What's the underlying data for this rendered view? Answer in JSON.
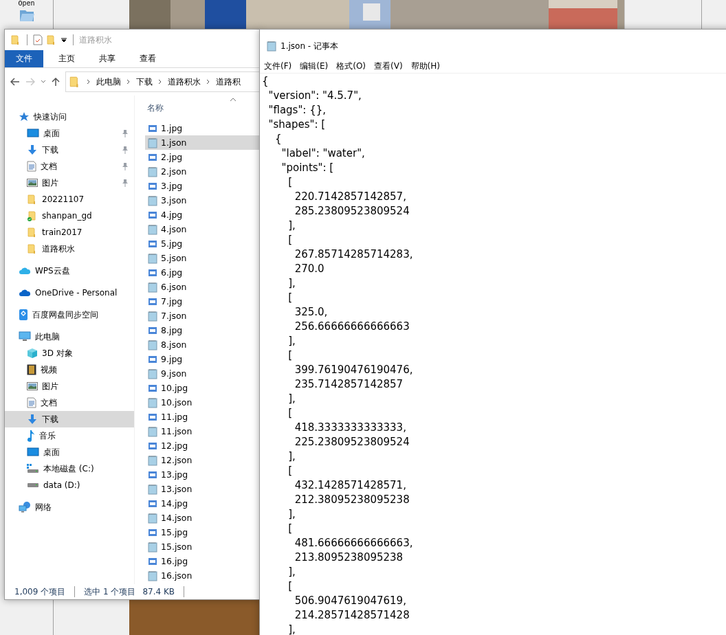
{
  "background_app": {
    "toolbar_button": "Open"
  },
  "explorer": {
    "title": "道路积水",
    "ribbon_tabs": [
      {
        "label": "文件",
        "kind": "file-menu"
      },
      {
        "label": "主页",
        "kind": "tab"
      },
      {
        "label": "共享",
        "kind": "tab"
      },
      {
        "label": "查看",
        "kind": "tab"
      }
    ],
    "nav": {
      "back_enabled": true,
      "forward_enabled": false
    },
    "breadcrumbs": [
      "此电脑",
      "下载",
      "道路积水",
      "道路积"
    ],
    "nav_pane": [
      {
        "label": "快速访问",
        "kind": "star",
        "selected": false,
        "children": [
          {
            "label": "桌面",
            "kind": "desktop",
            "pinned": true,
            "selected": false
          },
          {
            "label": "下载",
            "kind": "download",
            "pinned": true,
            "selected": false
          },
          {
            "label": "文档",
            "kind": "document",
            "pinned": true,
            "selected": false
          },
          {
            "label": "图片",
            "kind": "pictures",
            "pinned": true,
            "selected": false
          },
          {
            "label": "20221107",
            "kind": "folder",
            "pinned": false,
            "selected": false
          },
          {
            "label": "shanpan_gd",
            "kind": "folder-synced",
            "pinned": false,
            "selected": false
          },
          {
            "label": "train2017",
            "kind": "folder",
            "pinned": false,
            "selected": false
          },
          {
            "label": "道路积水",
            "kind": "folder",
            "pinned": false,
            "selected": false
          }
        ]
      },
      {
        "label": "WPS云盘",
        "kind": "cloud",
        "selected": false
      },
      {
        "label": "OneDrive - Personal",
        "kind": "onedrive",
        "selected": false
      },
      {
        "label": "百度网盘同步空间",
        "kind": "baidu",
        "selected": false
      },
      {
        "label": "此电脑",
        "kind": "computer",
        "selected": false,
        "children": [
          {
            "label": "3D 对象",
            "kind": "cube",
            "selected": false
          },
          {
            "label": "视频",
            "kind": "video",
            "selected": false
          },
          {
            "label": "图片",
            "kind": "pictures",
            "selected": false
          },
          {
            "label": "文档",
            "kind": "document",
            "selected": false
          },
          {
            "label": "下载",
            "kind": "download",
            "selected": true
          },
          {
            "label": "音乐",
            "kind": "music",
            "selected": false
          },
          {
            "label": "桌面",
            "kind": "desktop",
            "selected": false
          },
          {
            "label": "本地磁盘 (C:)",
            "kind": "system-drive",
            "selected": false
          },
          {
            "label": "data (D:)",
            "kind": "drive",
            "selected": false
          }
        ]
      },
      {
        "label": "网络",
        "kind": "network",
        "selected": false
      }
    ],
    "column_header": "名称",
    "files": [
      {
        "name": "1.jpg",
        "kind": "jpg",
        "selected": false
      },
      {
        "name": "1.json",
        "kind": "json",
        "selected": true
      },
      {
        "name": "2.jpg",
        "kind": "jpg",
        "selected": false
      },
      {
        "name": "2.json",
        "kind": "json",
        "selected": false
      },
      {
        "name": "3.jpg",
        "kind": "jpg",
        "selected": false
      },
      {
        "name": "3.json",
        "kind": "json",
        "selected": false
      },
      {
        "name": "4.jpg",
        "kind": "jpg",
        "selected": false
      },
      {
        "name": "4.json",
        "kind": "json",
        "selected": false
      },
      {
        "name": "5.jpg",
        "kind": "jpg",
        "selected": false
      },
      {
        "name": "5.json",
        "kind": "json",
        "selected": false
      },
      {
        "name": "6.jpg",
        "kind": "jpg",
        "selected": false
      },
      {
        "name": "6.json",
        "kind": "json",
        "selected": false
      },
      {
        "name": "7.jpg",
        "kind": "jpg",
        "selected": false
      },
      {
        "name": "7.json",
        "kind": "json",
        "selected": false
      },
      {
        "name": "8.jpg",
        "kind": "jpg",
        "selected": false
      },
      {
        "name": "8.json",
        "kind": "json",
        "selected": false
      },
      {
        "name": "9.jpg",
        "kind": "jpg",
        "selected": false
      },
      {
        "name": "9.json",
        "kind": "json",
        "selected": false
      },
      {
        "name": "10.jpg",
        "kind": "jpg",
        "selected": false
      },
      {
        "name": "10.json",
        "kind": "json",
        "selected": false
      },
      {
        "name": "11.jpg",
        "kind": "jpg",
        "selected": false
      },
      {
        "name": "11.json",
        "kind": "json",
        "selected": false
      },
      {
        "name": "12.jpg",
        "kind": "jpg",
        "selected": false
      },
      {
        "name": "12.json",
        "kind": "json",
        "selected": false
      },
      {
        "name": "13.jpg",
        "kind": "jpg",
        "selected": false
      },
      {
        "name": "13.json",
        "kind": "json",
        "selected": false
      },
      {
        "name": "14.jpg",
        "kind": "jpg",
        "selected": false
      },
      {
        "name": "14.json",
        "kind": "json",
        "selected": false
      },
      {
        "name": "15.jpg",
        "kind": "jpg",
        "selected": false
      },
      {
        "name": "15.json",
        "kind": "json",
        "selected": false
      },
      {
        "name": "16.jpg",
        "kind": "jpg",
        "selected": false
      },
      {
        "name": "16.json",
        "kind": "json",
        "selected": false
      }
    ],
    "status_bar": {
      "item_count": "1,009 个项目",
      "selection": "选中 1 个项目",
      "size": "87.4 KB"
    }
  },
  "notepad": {
    "title": "1.json - 记事本",
    "menu": [
      "文件(F)",
      "编辑(E)",
      "格式(O)",
      "查看(V)",
      "帮助(H)"
    ],
    "lines": [
      "{",
      "  \"version\": \"4.5.7\",",
      "  \"flags\": {},",
      "  \"shapes\": [",
      "    {",
      "      \"label\": \"water\",",
      "      \"points\": [",
      "        [",
      "          220.7142857142857,",
      "          285.23809523809524",
      "        ],",
      "        [",
      "          267.85714285714283,",
      "          270.0",
      "        ],",
      "        [",
      "          325.0,",
      "          256.66666666666663",
      "        ],",
      "        [",
      "          399.76190476190476,",
      "          235.7142857142857",
      "        ],",
      "        [",
      "          418.3333333333333,",
      "          225.23809523809524",
      "        ],",
      "        [",
      "          432.1428571428571,",
      "          212.38095238095238",
      "        ],",
      "        [",
      "          481.66666666666663,",
      "          213.8095238095238",
      "        ],",
      "        [",
      "          506.9047619047619,",
      "          214.28571428571428",
      "        ],"
    ]
  }
}
